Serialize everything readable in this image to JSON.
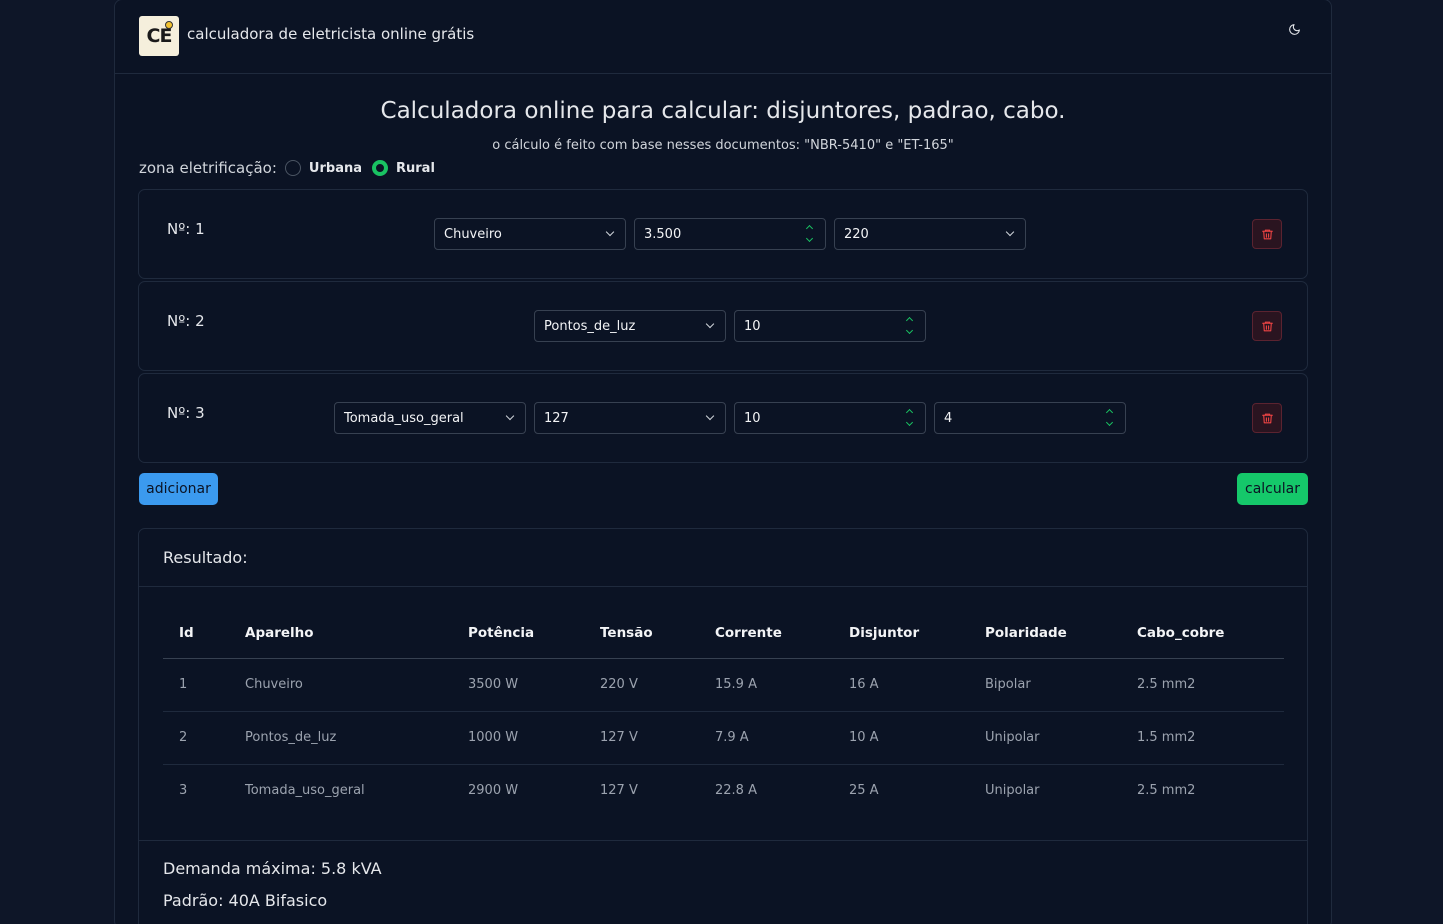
{
  "navbar": {
    "logo_text": "CE",
    "brand": "calculadora de eletricista online grátis",
    "theme_icon": "moon-icon"
  },
  "header": {
    "title": "Calculadora online para calcular: disjuntores, padrao, cabo.",
    "subtitle": "o cálculo é feito com base nesses documentos: \"NBR-5410\" e \"ET-165\""
  },
  "zone": {
    "label": "zona eletrificação:",
    "options": [
      {
        "label": "Urbana",
        "checked": false
      },
      {
        "label": "Rural",
        "checked": true
      }
    ]
  },
  "items": [
    {
      "num": "Nº: 1",
      "appliance": "Chuveiro",
      "power": "3.500",
      "voltage": "220"
    },
    {
      "num": "Nº: 2",
      "appliance": "Pontos_de_luz",
      "quantity": "10"
    },
    {
      "num": "Nº: 3",
      "appliance": "Tomada_uso_geral",
      "voltage": "127",
      "quantity": "10",
      "extra": "4"
    }
  ],
  "actions": {
    "add_label": "adicionar",
    "calc_label": "calcular"
  },
  "colors": {
    "add": "#3b9aef",
    "calc": "#15c86a",
    "accent": "#19c262",
    "danger": "#ef4444"
  },
  "result": {
    "title": "Resultado:",
    "columns": [
      "Id",
      "Aparelho",
      "Potência",
      "Tensão",
      "Corrente",
      "Disjuntor",
      "Polaridade",
      "Cabo_cobre"
    ],
    "rows": [
      [
        "1",
        "Chuveiro",
        "3500 W",
        "220 V",
        "15.9 A",
        "16 A",
        "Bipolar",
        "2.5 mm2"
      ],
      [
        "2",
        "Pontos_de_luz",
        "1000 W",
        "127 V",
        "7.9 A",
        "10 A",
        "Unipolar",
        "1.5 mm2"
      ],
      [
        "3",
        "Tomada_uso_geral",
        "2900 W",
        "127 V",
        "22.8 A",
        "25 A",
        "Unipolar",
        "2.5 mm2"
      ]
    ],
    "demand": "Demanda máxima: 5.8 kVA",
    "standard": "Padrão: 40A Bifasico"
  }
}
